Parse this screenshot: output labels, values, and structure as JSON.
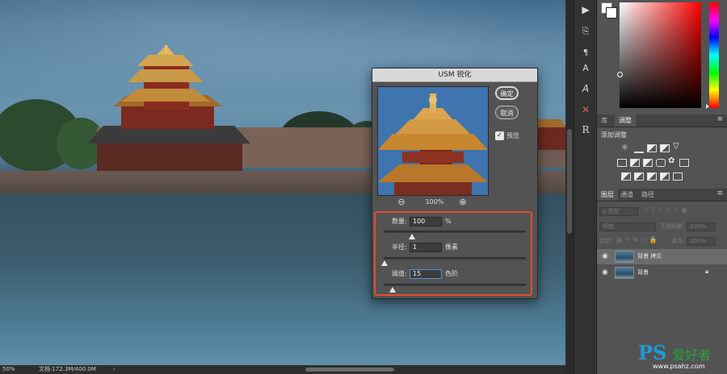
{
  "dialog": {
    "title": "USM 锐化",
    "ok_label": "确定",
    "cancel_label": "取消",
    "preview_label": "预览",
    "preview_checked": true,
    "zoom": "100%",
    "amount": {
      "label": "数量:",
      "value": "100",
      "unit": "%",
      "level": 0.2
    },
    "radius": {
      "label": "半径:",
      "value": "1",
      "unit": "像素",
      "level": 0.003
    },
    "threshold": {
      "label": "阈值:",
      "value": "15",
      "unit": "色阶",
      "level": 0.06
    }
  },
  "status": {
    "zoom": "50%",
    "doc_info": "文档:172.3M/400.0M",
    "arrow": "›"
  },
  "panels": {
    "tabs_top": [
      "库",
      "调整"
    ],
    "add_adjustment": "添加调整",
    "tabs_layers": [
      "图层",
      "通道",
      "路径"
    ],
    "filter_kind": "ρ 类型",
    "blend_mode": "明度",
    "opacity_label": "不透明度:",
    "opacity_value": "100%",
    "lock_label": "锁定:",
    "fill_label": "填充:",
    "fill_value": "100%",
    "layers": [
      {
        "name": "背景 拷贝",
        "selected": true,
        "locked": false
      },
      {
        "name": "背景",
        "selected": false,
        "locked": true
      }
    ]
  },
  "watermark": {
    "brand": "PS",
    "name": "爱好者",
    "url": "www.psahz.com"
  },
  "colors": {
    "accent": "#e2502c",
    "panel": "#535353",
    "dialog_title": "#d9d9d9"
  }
}
